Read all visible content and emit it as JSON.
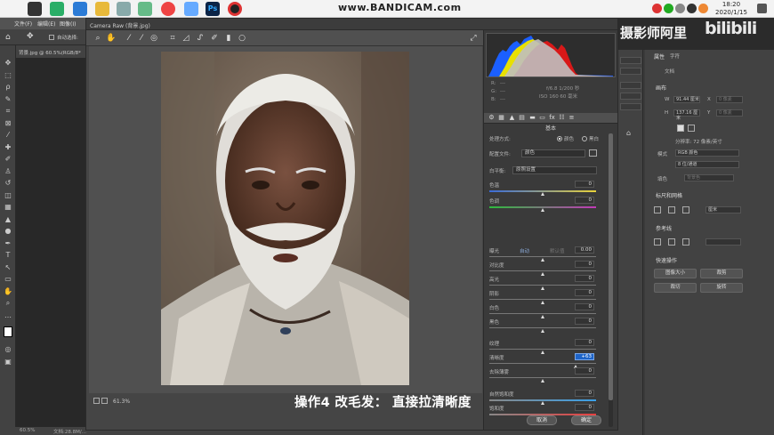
{
  "watermark": "www.BANDICAM.com",
  "clock": {
    "time": "18:20",
    "date": "2020/1/15"
  },
  "photoshop": {
    "menu": [
      "文件(F)",
      "编辑(E)",
      "图像(I)"
    ],
    "option_bar": {
      "auto_select_label": "自动选择:"
    },
    "doc_tab": "背景.jpg @ 60.5%(RGB/8*",
    "status": {
      "zoom": "60.5%",
      "doc_info": "文档:28.8M/..."
    }
  },
  "camera_raw": {
    "title": "Camera Raw (背景.jpg)",
    "zoom": "61.3%",
    "readouts": {
      "r": "R:",
      "g": "G:",
      "b": "B:",
      "r_val": "---",
      "g_val": "---",
      "b_val": "---",
      "exposure": "f/6.8  1/200 秒",
      "iso": "ISO 160  60 毫米"
    },
    "panel_title": "基本",
    "process": {
      "label": "处理方式:",
      "color": "颜色",
      "bw": "黑白"
    },
    "profile": {
      "label": "配置文件:",
      "value": "颜色"
    },
    "white_balance": {
      "label": "白平衡:",
      "value": "原照设置"
    },
    "auto_default": {
      "auto": "自动",
      "default": "默认值"
    },
    "sliders": [
      {
        "label": "色温",
        "value": "0",
        "level": 0.5
      },
      {
        "label": "色调",
        "value": "0",
        "level": 0.5
      },
      {
        "label": "曝光",
        "value": "0.00",
        "level": 0.5
      },
      {
        "label": "对比度",
        "value": "0",
        "level": 0.5
      },
      {
        "label": "高光",
        "value": "0",
        "level": 0.5
      },
      {
        "label": "阴影",
        "value": "0",
        "level": 0.5
      },
      {
        "label": "白色",
        "value": "0",
        "level": 0.5
      },
      {
        "label": "黑色",
        "value": "0",
        "level": 0.5
      },
      {
        "label": "纹理",
        "value": "0",
        "level": 0.5
      },
      {
        "label": "清晰度",
        "value": "+63",
        "level": 0.81
      },
      {
        "label": "去除薄雾",
        "value": "0",
        "level": 0.5
      },
      {
        "label": "自然饱和度",
        "value": "0",
        "level": 0.5
      },
      {
        "label": "饱和度",
        "value": "0",
        "level": 0.5
      }
    ],
    "buttons": {
      "cancel": "取消",
      "ok": "确定"
    }
  },
  "caption": "操作4  改毛发：  直接拉清晰度",
  "channel_name": "摄影师阿里",
  "bilibili_logo": "bilibili",
  "properties": {
    "tabs": [
      "属性",
      "字符"
    ],
    "doc_label": "文档",
    "canvas_head": "画布",
    "w_label": "W",
    "h_label": "H",
    "x_label": "X",
    "y_label": "Y",
    "w_value": "91.44 厘米",
    "h_value": "137.16 厘米",
    "x_value": "0 像素",
    "y_value": "0 像素",
    "resolution": "分辨率: 72 像素/英寸",
    "mode_label": "模式",
    "mode_value": "RGB 颜色",
    "depth_value": "8 位/通道",
    "fill_label": "填色",
    "fill_value": "背景色",
    "rulers_head": "标尺和网格",
    "unit_value": "厘米",
    "guides_head": "参考线",
    "quick_head": "快速操作",
    "quick_buttons": [
      "图像大小",
      "裁剪",
      "裁切",
      "旋转"
    ]
  },
  "colors": {
    "accent": "#1e64c8",
    "panel": "#424242",
    "dialog": "#454545"
  }
}
